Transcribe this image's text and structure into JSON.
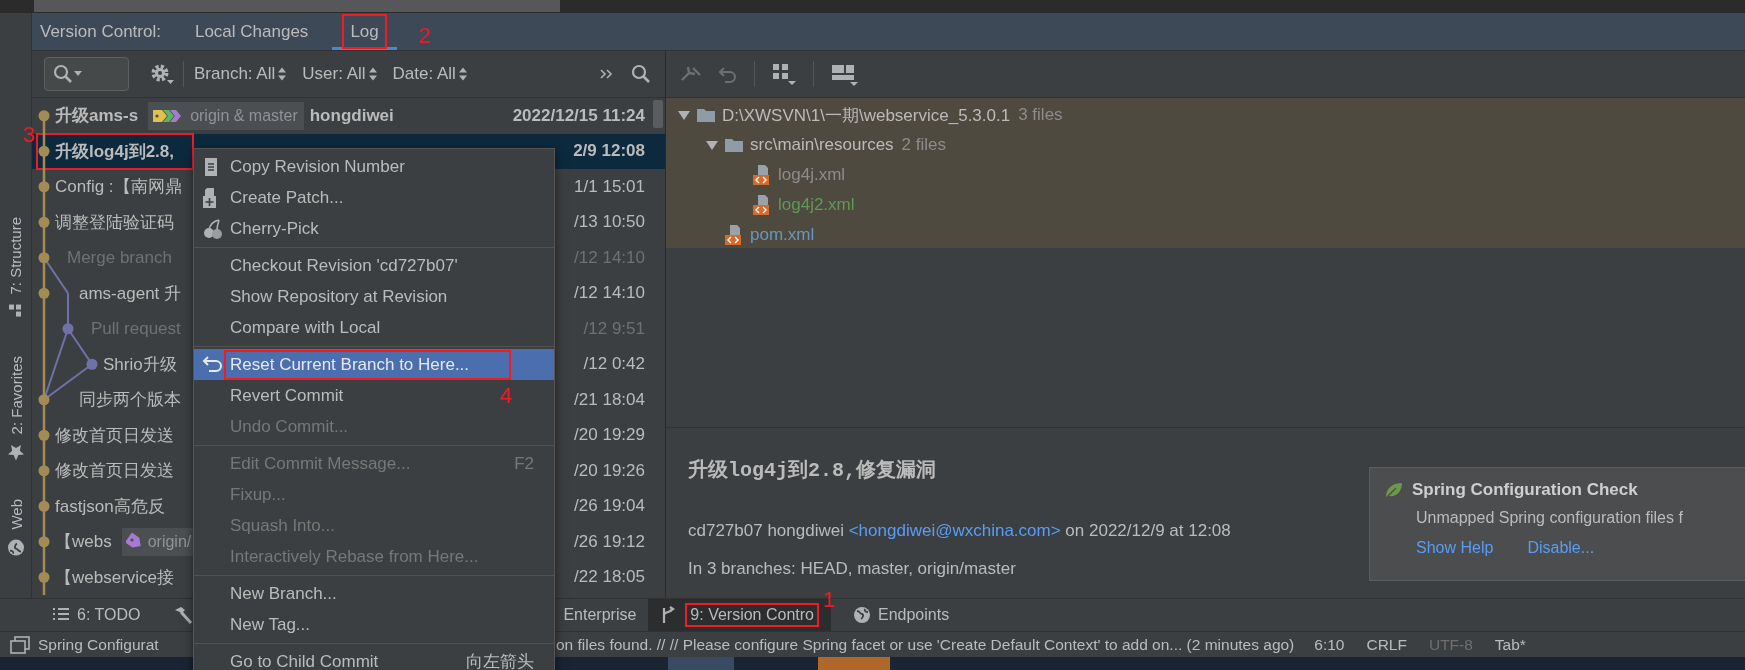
{
  "side_strip": [
    {
      "label": "7: Structure",
      "kind": "structure"
    },
    {
      "label": "2: Favorites",
      "kind": "favorites"
    },
    {
      "label": "Web",
      "kind": "web"
    }
  ],
  "tabs": {
    "title": "Version Control:",
    "items": [
      {
        "label": "Local Changes",
        "selected": false
      },
      {
        "label": "Log",
        "selected": true,
        "annotation": "2"
      }
    ]
  },
  "log": {
    "filters": [
      "Branch: All",
      "User: All",
      "Date: All"
    ],
    "commits": [
      {
        "message": "升级ams-s",
        "kind": "commit",
        "current_branch": true,
        "muted": false,
        "selected": false,
        "badge": {
          "label": "origin & master",
          "kind": "multi"
        },
        "author": "hongdiwei",
        "date": "2022/12/15 11:24"
      },
      {
        "message": "升级log4j到2.8,",
        "kind": "commit",
        "current_branch": true,
        "muted": false,
        "selected": true,
        "annotation": "3",
        "date": "2/9 12:08"
      },
      {
        "message": "Config :【南网鼎",
        "kind": "commit",
        "current_branch": false,
        "muted": false,
        "selected": false,
        "date": "1/1 15:01"
      },
      {
        "message": "调整登陆验证码",
        "kind": "commit",
        "current_branch": false,
        "muted": false,
        "selected": false,
        "date": "/13 10:50"
      },
      {
        "message": "Merge branch",
        "kind": "merge",
        "current_branch": false,
        "muted": true,
        "selected": false,
        "date": "/12 14:10"
      },
      {
        "message": "ams-agent 升",
        "kind": "commit",
        "current_branch": false,
        "muted": false,
        "selected": false,
        "date": "/12 14:10"
      },
      {
        "message": "Pull request",
        "kind": "side",
        "current_branch": false,
        "muted": true,
        "selected": false,
        "date": "/12 9:51"
      },
      {
        "message": "Shrio升级",
        "kind": "inner",
        "current_branch": false,
        "muted": false,
        "selected": false,
        "date": "/12 0:42"
      },
      {
        "message": "同步两个版本",
        "kind": "commit",
        "current_branch": false,
        "muted": false,
        "selected": false,
        "date": "/21 18:04"
      },
      {
        "message": "修改首页日发送",
        "kind": "commit",
        "current_branch": false,
        "muted": false,
        "selected": false,
        "date": "/20 19:29"
      },
      {
        "message": "修改首页日发送",
        "kind": "commit",
        "current_branch": false,
        "muted": false,
        "selected": false,
        "date": "/20 19:26"
      },
      {
        "message": "fastjson高危反",
        "kind": "commit",
        "current_branch": false,
        "muted": false,
        "selected": false,
        "date": "/26 19:04"
      },
      {
        "message": "【webs",
        "kind": "commit",
        "current_branch": false,
        "muted": false,
        "selected": false,
        "badge": {
          "label": "origin/",
          "kind": "remote"
        },
        "date": "/26 19:12"
      },
      {
        "message": "【webservice接",
        "kind": "commit",
        "current_branch": false,
        "muted": false,
        "selected": false,
        "date": "/22 18:05"
      }
    ]
  },
  "changes": {
    "tree": [
      {
        "name": "D:\\XWSVN\\1\\一期\\webservice_5.3.0.1",
        "kind": "folder",
        "count": "3 files",
        "expanded": true,
        "children": [
          {
            "name": "src\\main\\resources",
            "kind": "folder",
            "count": "2 files",
            "expanded": true,
            "children": [
              {
                "name": "log4j.xml",
                "kind": "deleted"
              },
              {
                "name": "log4j2.xml",
                "kind": "added"
              }
            ]
          },
          {
            "name": "pom.xml",
            "kind": "modified"
          }
        ]
      }
    ]
  },
  "details": {
    "title": "升级log4j到2.8,修复漏洞",
    "meta_before": "cd727b07 hongdiwei",
    "email": "<hongdiwei@wxchina.com>",
    "meta_after": "on 2022/12/9 at 12:08",
    "branches": "In 3 branches: HEAD, master, origin/master"
  },
  "notification": {
    "title": "Spring Configuration Check",
    "body": "Unmapped Spring configuration files f",
    "actions": [
      "Show Help",
      "Disable..."
    ]
  },
  "context_menu": {
    "groups": [
      [
        {
          "label": "Copy Revision Number",
          "kind": "copy",
          "selected": false,
          "disabled": false
        },
        {
          "label": "Create Patch...",
          "kind": "patch",
          "selected": false,
          "disabled": false
        },
        {
          "label": "Cherry-Pick",
          "kind": "cherry",
          "selected": false,
          "disabled": false
        }
      ],
      [
        {
          "label": "Checkout Revision 'cd727b07'",
          "kind": "plain",
          "selected": false,
          "disabled": false
        },
        {
          "label": "Show Repository at Revision",
          "kind": "plain",
          "selected": false,
          "disabled": false
        },
        {
          "label": "Compare with Local",
          "kind": "plain",
          "selected": false,
          "disabled": false
        }
      ],
      [
        {
          "label": "Reset Current Branch to Here...",
          "kind": "reset",
          "selected": true,
          "disabled": false,
          "annotation": "4"
        },
        {
          "label": "Revert Commit",
          "kind": "plain",
          "selected": false,
          "disabled": false
        },
        {
          "label": "Undo Commit...",
          "kind": "plain",
          "selected": false,
          "disabled": true
        }
      ],
      [
        {
          "label": "Edit Commit Message...",
          "kind": "plain",
          "selected": false,
          "disabled": true,
          "shortcut": "F2"
        },
        {
          "label": "Fixup...",
          "kind": "plain",
          "selected": false,
          "disabled": true
        },
        {
          "label": "Squash Into...",
          "kind": "plain",
          "selected": false,
          "disabled": true
        },
        {
          "label": "Interactively Rebase from Here...",
          "kind": "plain",
          "selected": false,
          "disabled": true
        }
      ],
      [
        {
          "label": "New Branch...",
          "kind": "plain",
          "selected": false,
          "disabled": false
        },
        {
          "label": "New Tag...",
          "kind": "plain",
          "selected": false,
          "disabled": false
        }
      ],
      [
        {
          "label": "Go to Child Commit",
          "kind": "plain",
          "selected": false,
          "disabled": false,
          "shortcut": "向左箭头"
        }
      ]
    ]
  },
  "tool_strip": [
    {
      "label": "6: TODO",
      "kind": "todo",
      "selected": false
    },
    {
      "kind": "build",
      "selected": false
    },
    {
      "label": "Enterprise",
      "kind": "plain",
      "selected": false
    },
    {
      "label": "9: Version Contro",
      "kind": "vcs",
      "selected": true,
      "annotation": "1"
    },
    {
      "label": "Endpoints",
      "kind": "endpoints",
      "selected": false
    }
  ],
  "status_bar": {
    "message_start": "Spring Configurat",
    "message_end": "on files found. // // Please configure Spring facet or use 'Create Default Context' to add on... (2 minutes ago)",
    "widgets": [
      {
        "label": "6:10",
        "disabled": false
      },
      {
        "label": "CRLF",
        "disabled": false
      },
      {
        "label": "UTF-8",
        "disabled": true
      },
      {
        "label": "Tab*",
        "disabled": false
      }
    ]
  }
}
